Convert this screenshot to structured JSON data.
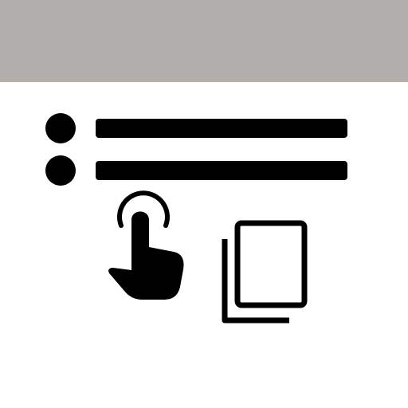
{
  "screen": {
    "header_color": "#b2aeac",
    "background_color": "#ffffff",
    "foreground_color": "#000000"
  },
  "icons": {
    "list": "bulleted-list-icon",
    "pointer": "tap-hand-icon",
    "copy": "copy-icon"
  }
}
